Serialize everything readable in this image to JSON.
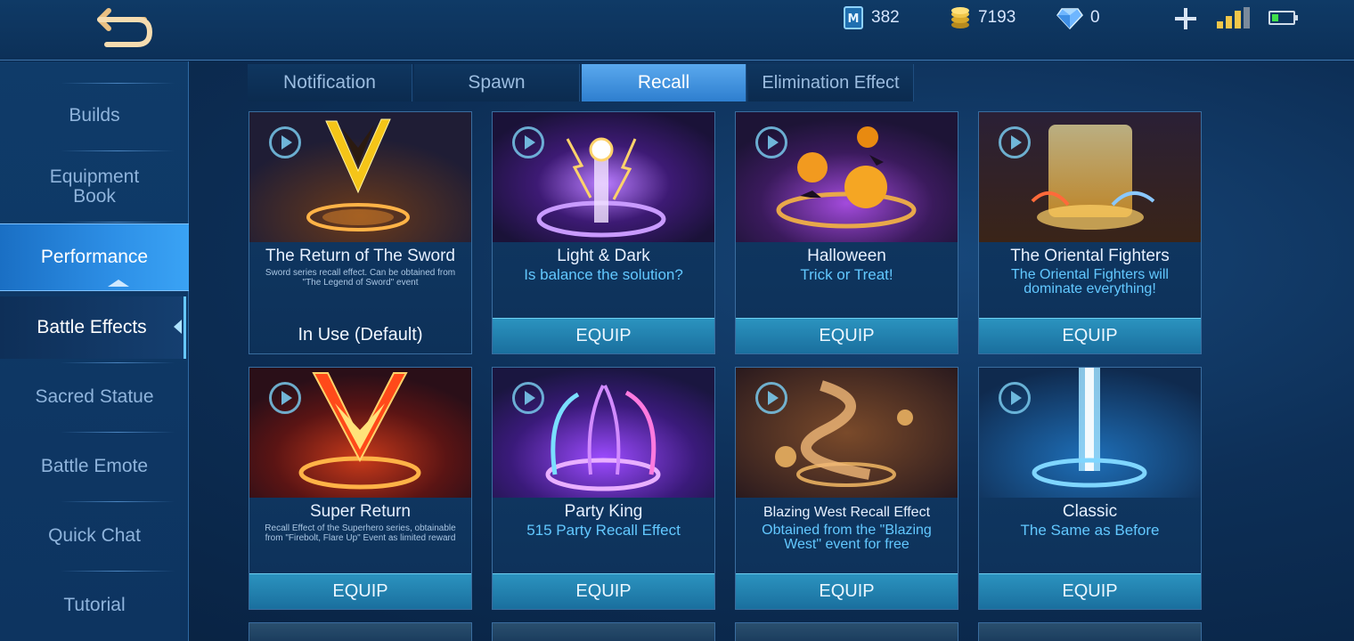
{
  "topbar": {
    "tickets": "382",
    "gold": "7193",
    "diamonds": "0"
  },
  "sidebar": {
    "items": [
      {
        "label": "Builds"
      },
      {
        "label": "Equipment Book"
      },
      {
        "label": "Performance"
      },
      {
        "label": "Battle Effects"
      },
      {
        "label": "Sacred Statue"
      },
      {
        "label": "Battle Emote"
      },
      {
        "label": "Quick Chat"
      },
      {
        "label": "Tutorial"
      }
    ]
  },
  "tabs": [
    {
      "label": "Notification"
    },
    {
      "label": "Spawn"
    },
    {
      "label": "Recall"
    },
    {
      "label": "Elimination Effect"
    }
  ],
  "cards": [
    {
      "title": "The Return of The Sword",
      "desc": "Sword series recall effect. Can be obtained from \"The Legend of Sword\" event",
      "button": "In Use (Default)"
    },
    {
      "title": "Light & Dark",
      "desc": "Is balance the solution?",
      "button": "EQUIP"
    },
    {
      "title": "Halloween",
      "desc": "Trick or Treat!",
      "button": "EQUIP"
    },
    {
      "title": "The Oriental Fighters",
      "desc": "The Oriental Fighters will dominate everything!",
      "button": "EQUIP"
    },
    {
      "title": "Super Return",
      "desc": "Recall Effect of the Superhero series, obtainable from \"Firebolt, Flare Up\" Event as limited reward",
      "button": "EQUIP"
    },
    {
      "title": "Party King",
      "desc": "515 Party Recall Effect",
      "button": "EQUIP"
    },
    {
      "title": "Blazing West Recall Effect",
      "desc": "Obtained from the \"Blazing West\" event for free",
      "button": "EQUIP"
    },
    {
      "title": "Classic",
      "desc": "The Same as Before",
      "button": "EQUIP"
    }
  ],
  "colors": {
    "accent": "#2e8fe6",
    "equip_button": "#1f82b2",
    "description_text": "#62c8ff"
  }
}
